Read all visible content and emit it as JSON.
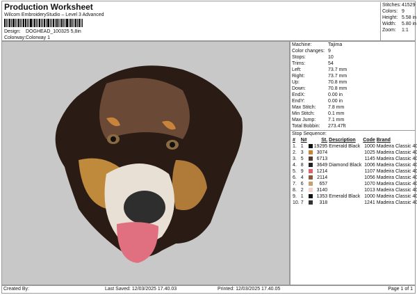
{
  "header": {
    "title": "Production Worksheet",
    "subtitle": "Wilcom EmbroideryStudio – Level 3 Advanced",
    "design_label": "Design:",
    "design_value": "DOGHEAD_100325 5,8in",
    "colorway_label": "Colorway:",
    "colorway_value": "Colorway 1"
  },
  "stats": [
    {
      "k": "Stitches:",
      "v": "41529"
    },
    {
      "k": "Colors:",
      "v": "9"
    },
    {
      "k": "Height:",
      "v": "5.58 in"
    },
    {
      "k": "Width:",
      "v": "5.80 in"
    },
    {
      "k": "Zoom:",
      "v": "1:1"
    }
  ],
  "machine": [
    {
      "k": "Machine:",
      "v": "Tajima"
    },
    {
      "k": "Color changes:",
      "v": "9"
    },
    {
      "k": "Stops:",
      "v": "10"
    },
    {
      "k": "Trims:",
      "v": "54"
    },
    {
      "k": "Left:",
      "v": "73.7 mm"
    },
    {
      "k": "Right:",
      "v": "73.7 mm"
    },
    {
      "k": "Up:",
      "v": "70.8 mm"
    },
    {
      "k": "Down:",
      "v": "70.8 mm"
    },
    {
      "k": "EndX:",
      "v": "0.00 in"
    },
    {
      "k": "EndY:",
      "v": "0.00 in"
    },
    {
      "k": "Max Stitch:",
      "v": "7.8 mm"
    },
    {
      "k": "Min Stitch:",
      "v": "0.1 mm"
    },
    {
      "k": "Max Jump:",
      "v": "7.1 mm"
    },
    {
      "k": "Total Bobbin:",
      "v": "273.47ft"
    }
  ],
  "stop_sequence": {
    "title": "Stop Sequence:",
    "headers": [
      "#",
      "N#",
      "St.",
      "Description",
      "Code",
      "Brand"
    ],
    "rows": [
      [
        "1.",
        "1",
        "#111111",
        "19295",
        "Emerald Black",
        "1000",
        "Madeira Classic 40"
      ],
      [
        "2.",
        "3",
        "#c8843a",
        "3074",
        "",
        "1025",
        "Madeira Classic 40"
      ],
      [
        "3.",
        "5",
        "#5a3a2a",
        "6713",
        "",
        "1145",
        "Madeira Classic 40"
      ],
      [
        "4.",
        "8",
        "#222222",
        "3649",
        "Diamond Black",
        "1006",
        "Madeira Classic 40"
      ],
      [
        "5.",
        "9",
        "#e06070",
        "1214",
        "",
        "1107",
        "Madeira Classic 40"
      ],
      [
        "6.",
        "4",
        "#8a5a3a",
        "2114",
        "",
        "1056",
        "Madeira Classic 40"
      ],
      [
        "7.",
        "6",
        "#c8a070",
        "657",
        "",
        "1070",
        "Madeira Classic 40"
      ],
      [
        "8.",
        "2",
        "#f0d4cc",
        "3140",
        "",
        "1013",
        "Madeira Classic 40"
      ],
      [
        "9.",
        "1",
        "#111111",
        "1353",
        "Emerald Black",
        "1000",
        "Madeira Classic 40"
      ],
      [
        "10.",
        "7",
        "#303438",
        "318",
        "",
        "1241",
        "Madeira Classic 40"
      ]
    ]
  },
  "footer": {
    "created": "Created By:",
    "saved": "Last Saved: 12/03/2025 17.40.03",
    "printed": "Printed: 12/03/2025 17.40.05",
    "page": "Page 1 of 1"
  }
}
